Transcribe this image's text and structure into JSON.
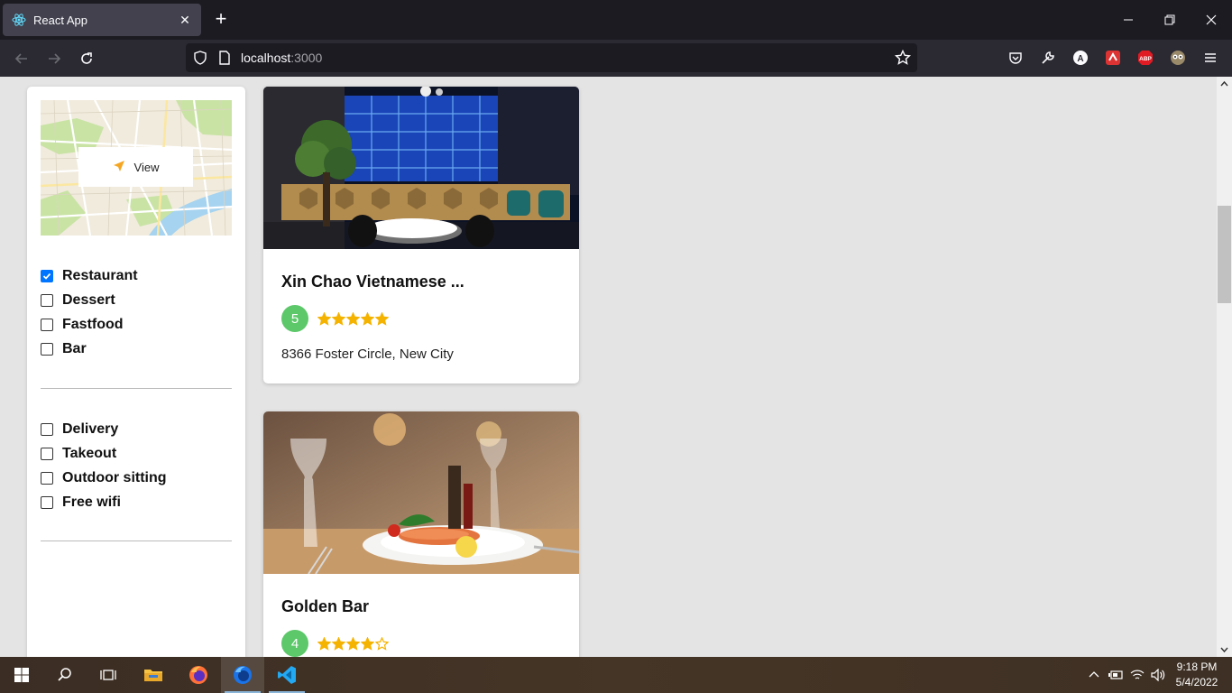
{
  "browser": {
    "tab_title": "React App",
    "url_host": "localhost",
    "url_port": ":3000"
  },
  "sidebar": {
    "map_button_label": "View",
    "categories": [
      {
        "label": "Restaurant",
        "checked": true
      },
      {
        "label": "Dessert",
        "checked": false
      },
      {
        "label": "Fastfood",
        "checked": false
      },
      {
        "label": "Bar",
        "checked": false
      }
    ],
    "amenities": [
      {
        "label": "Delivery",
        "checked": false
      },
      {
        "label": "Takeout",
        "checked": false
      },
      {
        "label": "Outdoor sitting",
        "checked": false
      },
      {
        "label": "Free wifi",
        "checked": false
      }
    ]
  },
  "listings": [
    {
      "name": "Xin Chao Vietnamese ...",
      "rating": "5",
      "stars": 5,
      "address": "8366 Foster Circle, New City"
    },
    {
      "name": "Golden Bar",
      "rating": "4",
      "stars": 4,
      "address": ""
    }
  ],
  "taskbar": {
    "time": "9:18 PM",
    "date": "5/4/2022"
  },
  "colors": {
    "star": "#f5b301",
    "rating_badge": "#5cc86a",
    "checkbox_checked": "#0075ff"
  }
}
